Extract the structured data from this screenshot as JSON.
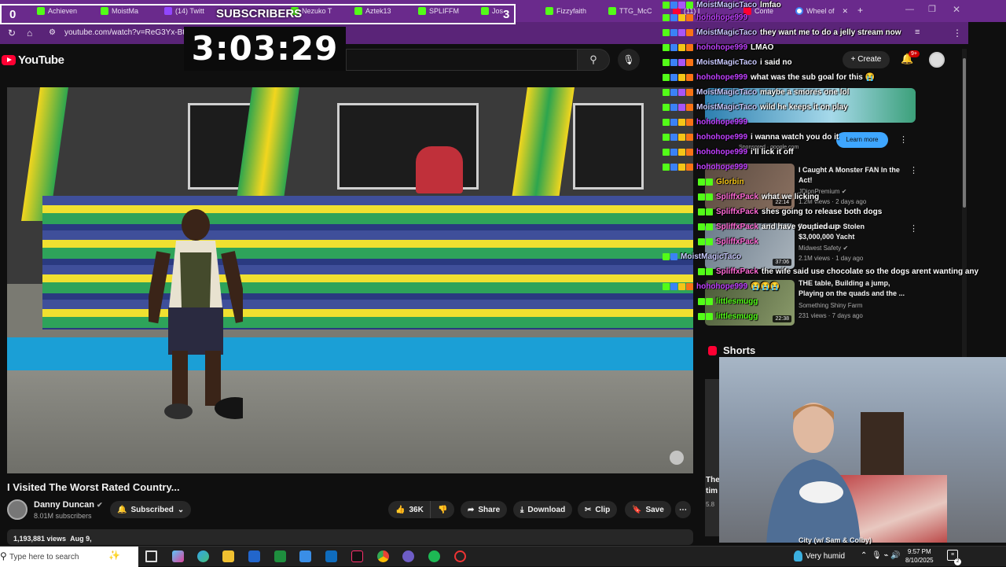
{
  "browser": {
    "tabs": [
      {
        "label": "Achieven",
        "fav": "kick"
      },
      {
        "label": "MoistMa",
        "fav": "kick"
      },
      {
        "label": "(14) Twitt",
        "fav": "twitch"
      },
      {
        "label": "Nezuko T",
        "fav": "kick"
      },
      {
        "label": "Aztek13",
        "fav": "kick"
      },
      {
        "label": "SPLIFFM",
        "fav": "kick"
      },
      {
        "label": "Jos",
        "fav": "kick"
      },
      {
        "label": "Fizzyfaith",
        "fav": "kick"
      },
      {
        "label": "TTG_McC",
        "fav": "kick"
      },
      {
        "label": "(11) I",
        "fav": "youtube"
      },
      {
        "label": "Conte",
        "fav": "youtube"
      },
      {
        "label": "Wheel of",
        "fav": "google"
      }
    ],
    "url": "youtube.com/watch?v=ReG3Yx-Btig"
  },
  "overlay": {
    "sub_left": "0",
    "sub_label": "SUBSCRIBERS",
    "sub_right": "3",
    "timer": "3:03:29"
  },
  "youtube": {
    "logo_text": "YouTube",
    "create_label": "Create",
    "notif_count": "9+",
    "video_title": "I Visited The Worst Rated Country...",
    "channel_name": "Danny Duncan",
    "channel_subs": "8.01M subscribers",
    "subscribed_label": "Subscribed",
    "likes": "36K",
    "share_label": "Share",
    "download_label": "Download",
    "clip_label": "Clip",
    "save_label": "Save",
    "views": "1,193,881 views",
    "date": "Aug 9,"
  },
  "sidebar": {
    "ad": {
      "learn_more": "Learn more",
      "sponsored": "Sponsored · google.com"
    },
    "recommendations": [
      {
        "title": "I Caught A Monster FAN In the Act!",
        "channel": "JDionPremium",
        "meta": "1.2M views · 2 days ago",
        "duration": "22:14",
        "verified": true
      },
      {
        "title": "Response to Stolen $3,000,000 Yacht",
        "channel": "Midwest Safety",
        "meta": "2.1M views · 1 day ago",
        "duration": "37:06",
        "verified": true
      },
      {
        "title": "THE table, Building a jump, Playing on the quads and the ...",
        "channel": "Something Shiny Farm",
        "meta": "231 views · 7 days ago",
        "duration": "22:38",
        "verified": false
      }
    ],
    "shorts_label": "Shorts",
    "shorts_title_fragment": "The",
    "shorts_time_fragment": "tim",
    "shorts_views_fragment": "5.8"
  },
  "chat": [
    {
      "user": "MoistMagicTaco",
      "msg": "lmfao",
      "color": "#c9c9ff",
      "badges": [
        "k",
        "b",
        "p",
        "bo"
      ]
    },
    {
      "user": "hohohope999",
      "msg": "",
      "color": "#c040ff",
      "badges": [
        "k",
        "b",
        "y",
        "o"
      ]
    },
    {
      "user": "MoistMagicTaco",
      "msg": "they want me to do a jelly stream now",
      "color": "#c9c9ff",
      "badges": [
        "k",
        "b",
        "p",
        "o"
      ]
    },
    {
      "user": "hohohope999",
      "msg": "LMAO",
      "color": "#c040ff",
      "badges": [
        "k",
        "b",
        "y",
        "o"
      ]
    },
    {
      "user": "MoistMagicTaco",
      "msg": "i said no",
      "color": "#c9c9ff",
      "badges": [
        "k",
        "b",
        "p",
        "o"
      ]
    },
    {
      "user": "hohohope999",
      "msg": "what was the sub goal for this 😭",
      "color": "#c040ff",
      "badges": [
        "k",
        "b",
        "y",
        "o"
      ]
    },
    {
      "user": "MoistMagicTaco",
      "msg": "maybe a smores one lol",
      "color": "#c9c9ff",
      "badges": [
        "k",
        "b",
        "p",
        "o"
      ]
    },
    {
      "user": "MoistMagicTaco",
      "msg": "wild he keeps it on play",
      "color": "#c9c9ff",
      "badges": [
        "k",
        "b",
        "p",
        "o"
      ]
    },
    {
      "user": "hohohope999",
      "msg": "",
      "color": "#c040ff",
      "badges": [
        "k",
        "b",
        "y",
        "o"
      ]
    },
    {
      "user": "hohohope999",
      "msg": "i wanna watch you do it",
      "color": "#c040ff",
      "badges": [
        "k",
        "b",
        "y",
        "o"
      ]
    },
    {
      "user": "hohohope999",
      "msg": "i'll lick it off",
      "color": "#c040ff",
      "badges": [
        "k",
        "b",
        "y",
        "o"
      ]
    },
    {
      "user": "hohohope999",
      "msg": "",
      "color": "#c040ff",
      "badges": [
        "k",
        "b",
        "y",
        "o"
      ]
    },
    {
      "user": "Glorbin",
      "msg": "",
      "color": "#f5c518",
      "badges": [
        "k",
        "g"
      ]
    },
    {
      "user": "SpliffxPack",
      "msg": "what we licking",
      "color": "#ff6ad5",
      "badges": [
        "k",
        "g"
      ]
    },
    {
      "user": "SpliffxPack",
      "msg": "shes going to release both dogs",
      "color": "#ff6ad5",
      "badges": [
        "k",
        "g"
      ]
    },
    {
      "user": "SpliffxPack",
      "msg": "and have you tied up",
      "color": "#ff6ad5",
      "badges": [
        "k",
        "g"
      ]
    },
    {
      "user": "SpliffxPack",
      "msg": "",
      "color": "#ff6ad5",
      "badges": [
        "k",
        "g"
      ]
    },
    {
      "user": "MoistMagicTaco",
      "msg": "",
      "color": "#c9c9ff",
      "badges": [
        "k",
        "b"
      ]
    },
    {
      "user": "SpliffxPack",
      "msg": "the wife said use chocolate so the dogs arent wanting any",
      "color": "#ff6ad5",
      "badges": [
        "k",
        "g"
      ]
    },
    {
      "user": "hohohope999",
      "msg": "😭😭😭",
      "color": "#c040ff",
      "badges": [
        "k",
        "b",
        "y",
        "o"
      ]
    },
    {
      "user": "littlesmugg",
      "msg": "",
      "color": "#53fc18",
      "badges": [
        "k",
        "g"
      ]
    },
    {
      "user": "littlesmugg",
      "msg": "",
      "color": "#53fc18",
      "badges": [
        "k",
        "g"
      ]
    }
  ],
  "webcam": {
    "caption": "City (w/ Sam & Colby)"
  },
  "taskbar": {
    "search_placeholder": "Type here to search",
    "weather": "Very humid",
    "time": "9:57 PM",
    "date": "8/10/2025",
    "notif_count": "2"
  }
}
